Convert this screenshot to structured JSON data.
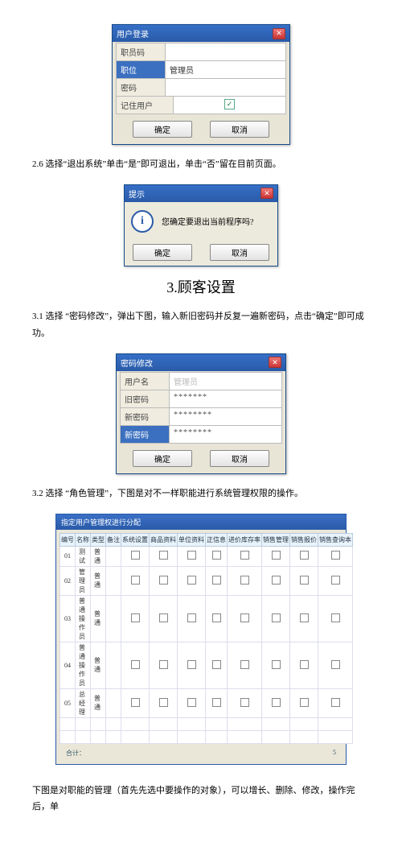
{
  "login": {
    "title": "用户登录",
    "rows": {
      "staff_label": "职员码",
      "role_label": "职位",
      "role_value": "管理员",
      "pwd_label": "密码",
      "remember_label": "记住用户"
    },
    "ok": "确定",
    "cancel": "取消"
  },
  "para26": "2.6 选择“退出系统”单击“是”即可退出，单击“否”留在目前页面。",
  "msgbox": {
    "title": "提示",
    "text": "您确定要退出当前程序吗?",
    "ok": "确定",
    "cancel": "取消"
  },
  "section3": "3.顾客设置",
  "para31": "3.1 选择 “密码修改”，弹出下图，输入新旧密码并反复一遍新密码，点击“确定”即可成功。",
  "pwchange": {
    "title": "密码修改",
    "user_label": "用户名",
    "user_value": "管理员",
    "old_label": "旧密码",
    "new_label": "新密码",
    "new2_label": "新密码",
    "dots7": "*******",
    "dots8": "********",
    "ok": "确定",
    "cancel": "取消"
  },
  "para32": "3.2 选择 “角色管理”，下图是对不一样职能进行系统管理权限的操作。",
  "perm": {
    "title": "指定用户管理权进行分配",
    "headers": [
      "编号",
      "名称",
      "类型",
      "备注",
      "系统设置",
      "商品资料",
      "单位资料",
      "正信息",
      "进价库存率",
      "销售管理",
      "销售报价",
      "销售查询本"
    ],
    "rows": [
      {
        "id": "01",
        "name": "测试",
        "type": "普通"
      },
      {
        "id": "02",
        "name": "管理员",
        "type": "普通"
      },
      {
        "id": "03",
        "name": "普通操作员",
        "type": "普通"
      },
      {
        "id": "04",
        "name": "普通操作员",
        "type": "普通"
      },
      {
        "id": "05",
        "name": "总经理",
        "type": "普通"
      }
    ],
    "footer_left": "合计：",
    "footer_right": "5"
  },
  "para_tail": "下图是对职能的管理（首先先选中要操作的对象），可以增长、删除、修改，操作完后，单"
}
